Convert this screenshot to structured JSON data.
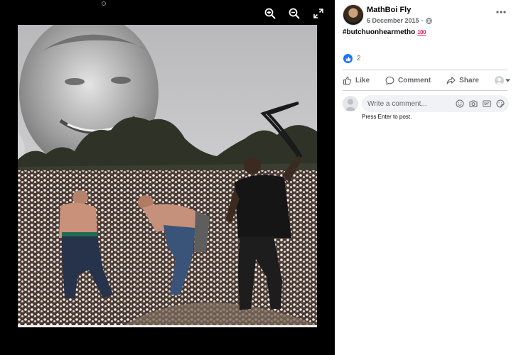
{
  "viewer": {
    "tools": [
      {
        "icon": "zoom-in-icon"
      },
      {
        "icon": "zoom-out-icon"
      },
      {
        "icon": "fullscreen-icon"
      }
    ]
  },
  "post": {
    "author": "MathBoi Fly",
    "date": "6 December 2015",
    "meta_separator": "·",
    "privacy_icon": "globe-icon",
    "caption": "#butchuonhearmetho",
    "caption_emoji": "100",
    "reactions": {
      "icon": "like-reaction-icon",
      "count": "2"
    }
  },
  "actions": [
    {
      "label": "Like",
      "icon": "thumbs-up-icon"
    },
    {
      "label": "Comment",
      "icon": "comment-icon"
    },
    {
      "label": "Share",
      "icon": "share-icon"
    }
  ],
  "comment": {
    "placeholder": "Write a comment...",
    "hint": "Press Enter to post.",
    "tools": [
      "emoji-icon",
      "camera-icon",
      "gif-icon",
      "sticker-icon"
    ]
  },
  "colors": {
    "viewer_bg": "#000000",
    "panel_bg": "#ffffff",
    "accent": "#1877f2",
    "secondary_text": "#65676b"
  }
}
